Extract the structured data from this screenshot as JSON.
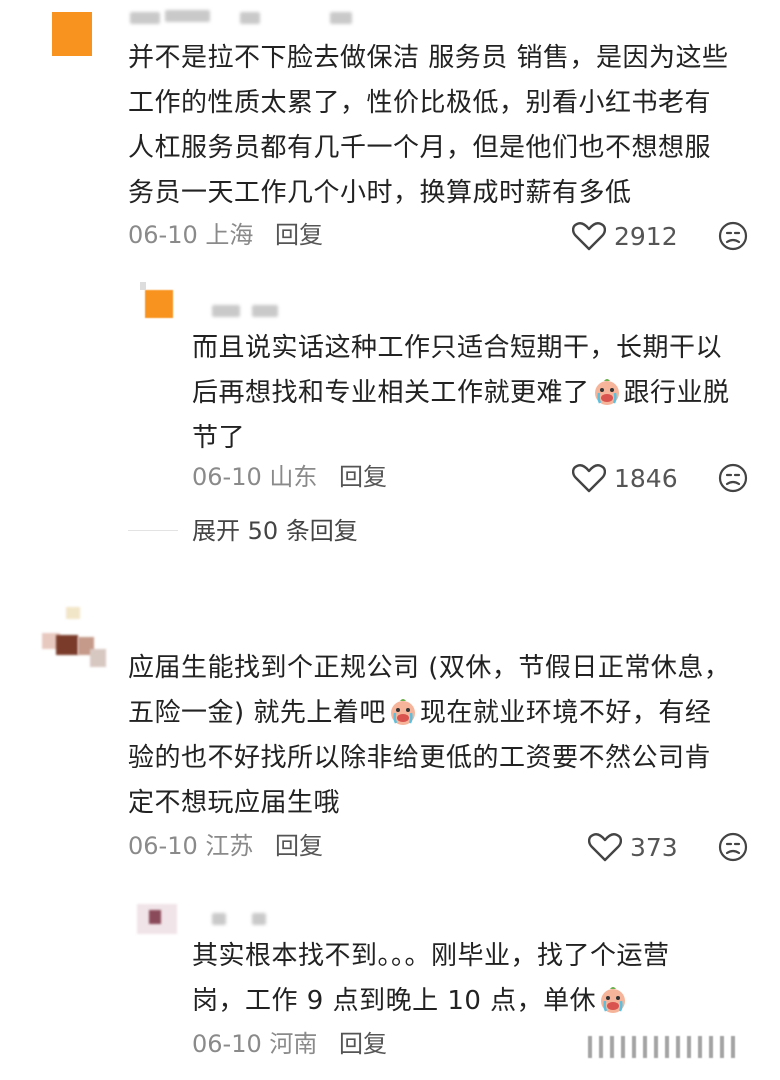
{
  "comments": [
    {
      "text": "并不是拉不下脸去做保洁 服务员 销售，是因为这些工作的性质太累了，性价比极低，别看小红书老有人杠服务员都有几千一个月，但是他们也不想想服务员一天工作几个小时，换算成时薪有多低",
      "lines": [
        "并不是拉不下脸去做保洁 服务员 销售，是因为这些",
        "工作的性质太累了，性价比极低，别看小红书老有",
        "人杠服务员都有几千一个月，但是他们也不想想服",
        "务员一天工作几个小时，换算成时薪有多低"
      ],
      "date": "06-10",
      "location": "上海",
      "reply_label": "回复",
      "likes": "2912"
    },
    {
      "line1": "而且说实话这种工作只适合短期干，长期干以",
      "line2a": "后再想找和专业相关工作就更难了",
      "line2b": "跟行业脱",
      "line3": "节了",
      "date": "06-10",
      "location": "山东",
      "reply_label": "回复",
      "likes": "1846"
    },
    {
      "line1": "应届生能找到个正规公司 (双休，节假日正常休息，",
      "line2a": "五险一金) 就先上着吧",
      "line2b": "现在就业环境不好，有经",
      "line3": "验的也不好找所以除非给更低的工资要不然公司肯",
      "line4": "定不想玩应届生哦",
      "date": "06-10",
      "location": "江苏",
      "reply_label": "回复",
      "likes": "373"
    },
    {
      "line1": "其实根本找不到。。。刚毕业，找了个运营",
      "line2": "岗，工作 9 点到晚上 10 点，单休",
      "date": "06-10",
      "location": "河南",
      "reply_label": "回复"
    }
  ],
  "expand_replies": "展开 50 条回复",
  "icons": {
    "like": "heart-outline-icon",
    "dislike": "unhappy-face-icon",
    "emoji": "crying-emoji-icon"
  },
  "colors": {
    "text": "#222222",
    "meta": "#8a8a8a",
    "avatar1": "#f7931e"
  }
}
